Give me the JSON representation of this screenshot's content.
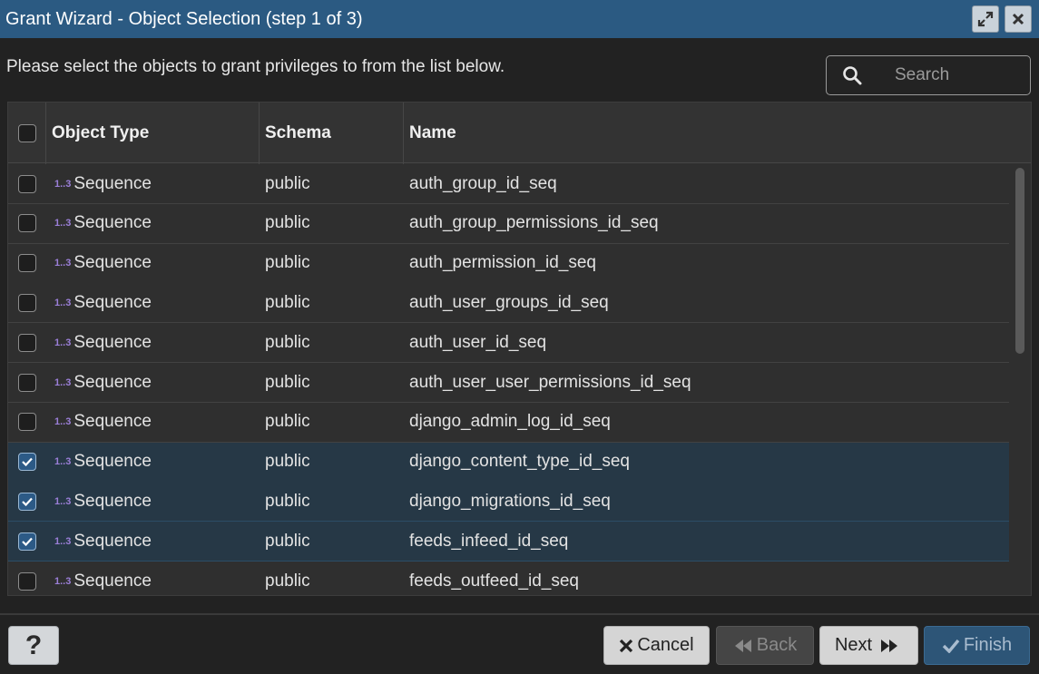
{
  "window": {
    "title": "Grant Wizard - Object Selection (step 1 of 3)",
    "maximize_icon": "expand-icon",
    "close_icon": "close-icon"
  },
  "instruction": "Please select the objects to grant privileges to from the list below.",
  "search": {
    "placeholder": "Search",
    "value": ""
  },
  "table": {
    "columns": [
      "Object Type",
      "Schema",
      "Name"
    ],
    "type_icon_text": "1..3",
    "rows": [
      {
        "type": "Sequence",
        "schema": "public",
        "name": "auth_group_id_seq",
        "checked": false
      },
      {
        "type": "Sequence",
        "schema": "public",
        "name": "auth_group_permissions_id_seq",
        "checked": false
      },
      {
        "type": "Sequence",
        "schema": "public",
        "name": "auth_permission_id_seq",
        "checked": false
      },
      {
        "type": "Sequence",
        "schema": "public",
        "name": "auth_user_groups_id_seq",
        "checked": false
      },
      {
        "type": "Sequence",
        "schema": "public",
        "name": "auth_user_id_seq",
        "checked": false
      },
      {
        "type": "Sequence",
        "schema": "public",
        "name": "auth_user_user_permissions_id_seq",
        "checked": false
      },
      {
        "type": "Sequence",
        "schema": "public",
        "name": "django_admin_log_id_seq",
        "checked": false
      },
      {
        "type": "Sequence",
        "schema": "public",
        "name": "django_content_type_id_seq",
        "checked": true
      },
      {
        "type": "Sequence",
        "schema": "public",
        "name": "django_migrations_id_seq",
        "checked": true
      },
      {
        "type": "Sequence",
        "schema": "public",
        "name": "feeds_infeed_id_seq",
        "checked": true
      },
      {
        "type": "Sequence",
        "schema": "public",
        "name": "feeds_outfeed_id_seq",
        "checked": false
      }
    ]
  },
  "footer": {
    "help_label": "?",
    "cancel_label": "Cancel",
    "back_label": "Back",
    "next_label": "Next",
    "finish_label": "Finish"
  },
  "colors": {
    "titlebar": "#2b5a82",
    "selected_row": "#263846",
    "finish_button": "#2d5577",
    "sequence_icon": "#9b7fd8"
  }
}
